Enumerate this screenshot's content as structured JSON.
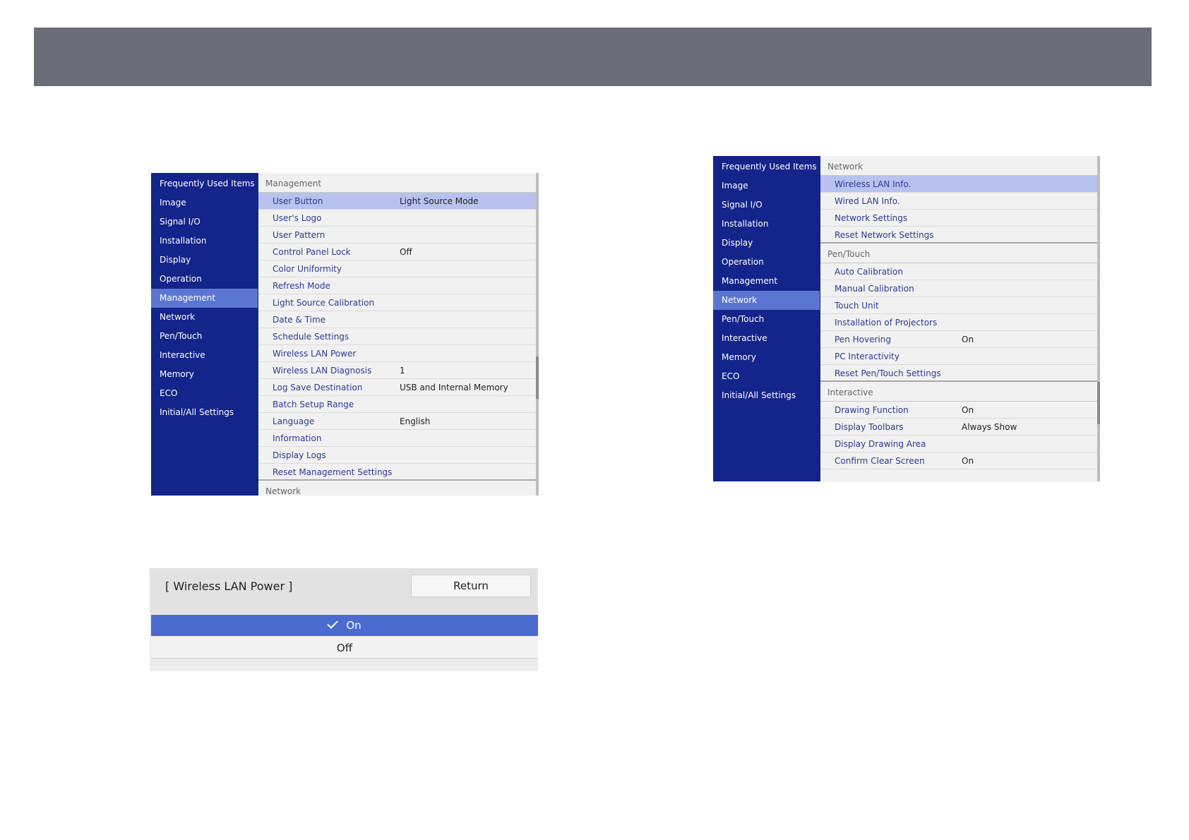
{
  "menu_left": {
    "sidebar": [
      "Frequently Used Items",
      "Image",
      "Signal I/O",
      "Installation",
      "Display",
      "Operation",
      "Management",
      "Network",
      "Pen/Touch",
      "Interactive",
      "Memory",
      "ECO",
      "Initial/All Settings"
    ],
    "active_item": "Management",
    "section_title": "Management",
    "rows": [
      {
        "label": "User Button",
        "value": "Light Source Mode"
      },
      {
        "label": "User's Logo",
        "value": ""
      },
      {
        "label": "User Pattern",
        "value": ""
      },
      {
        "label": "Control Panel Lock",
        "value": "Off"
      },
      {
        "label": "Color Uniformity",
        "value": ""
      },
      {
        "label": "Refresh Mode",
        "value": ""
      },
      {
        "label": "Light Source Calibration",
        "value": ""
      },
      {
        "label": "Date & Time",
        "value": ""
      },
      {
        "label": "Schedule Settings",
        "value": ""
      },
      {
        "label": "Wireless LAN Power",
        "value": ""
      },
      {
        "label": "Wireless LAN Diagnosis",
        "value": "1"
      },
      {
        "label": "Log Save Destination",
        "value": "USB and Internal Memory"
      },
      {
        "label": "Batch Setup Range",
        "value": ""
      },
      {
        "label": "Language",
        "value": "English"
      },
      {
        "label": "Information",
        "value": ""
      },
      {
        "label": "Display Logs",
        "value": ""
      },
      {
        "label": "Reset Management Settings",
        "value": ""
      }
    ],
    "next_section": "Network"
  },
  "menu_right": {
    "sidebar": [
      "Frequently Used Items",
      "Image",
      "Signal I/O",
      "Installation",
      "Display",
      "Operation",
      "Management",
      "Network",
      "Pen/Touch",
      "Interactive",
      "Memory",
      "ECO",
      "Initial/All Settings"
    ],
    "active_item": "Network",
    "sections": [
      {
        "title": "Network",
        "rows": [
          {
            "label": "Wireless LAN Info.",
            "value": ""
          },
          {
            "label": "Wired LAN Info.",
            "value": ""
          },
          {
            "label": "Network Settings",
            "value": ""
          },
          {
            "label": "Reset Network Settings",
            "value": ""
          }
        ]
      },
      {
        "title": "Pen/Touch",
        "rows": [
          {
            "label": "Auto Calibration",
            "value": ""
          },
          {
            "label": "Manual Calibration",
            "value": ""
          },
          {
            "label": "Touch Unit",
            "value": ""
          },
          {
            "label": "Installation of Projectors",
            "value": ""
          },
          {
            "label": "Pen Hovering",
            "value": "On"
          },
          {
            "label": "PC Interactivity",
            "value": ""
          },
          {
            "label": "Reset Pen/Touch Settings",
            "value": ""
          }
        ]
      },
      {
        "title": "Interactive",
        "rows": [
          {
            "label": "Drawing Function",
            "value": "On"
          },
          {
            "label": "Display Toolbars",
            "value": "Always Show"
          },
          {
            "label": "Display Drawing Area",
            "value": ""
          },
          {
            "label": "Confirm Clear Screen",
            "value": "On"
          }
        ]
      }
    ]
  },
  "dialog": {
    "title": "[ Wireless LAN Power ]",
    "return_label": "Return",
    "options": [
      "On",
      "Off"
    ],
    "selected": "On"
  },
  "colors": {
    "sidebar_bg": "#13248a",
    "sidebar_active": "#5b76d0",
    "row_selected": "#b7c2ee",
    "option_selected": "#4a6bd0",
    "banner": "#6b6e78"
  }
}
